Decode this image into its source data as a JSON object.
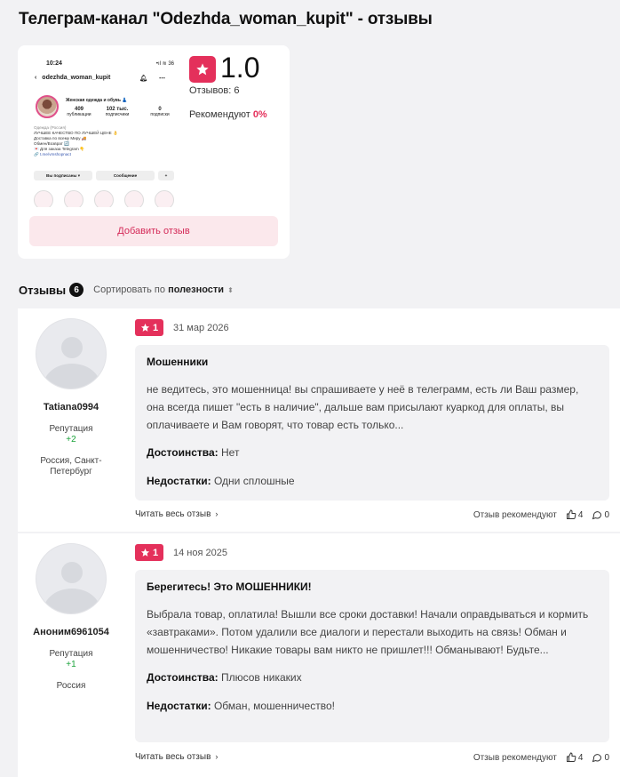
{
  "page": {
    "title": "Телеграм-канал \"Odezhda_woman_kupit\" - отзывы"
  },
  "summary": {
    "screenshot": {
      "time": "10:24",
      "status_right": "•ıl ≋ 36",
      "channel": "odezhda_woman_kupit",
      "name": "Женская одежда и обувь 👗",
      "stats": [
        {
          "value": "409",
          "label": "публикации"
        },
        {
          "value": "102 тыс.",
          "label": "подписчики"
        },
        {
          "value": "0",
          "label": "подписки"
        }
      ],
      "bio_lines": [
        "Одежда (Россия)",
        "ЛУЧШЕЕ КАЧЕСТВО ПО ЛУЧШЕЙ ЦЕНЕ 👌",
        "Доставка по всему Миру 🚚",
        "Обмен/Возврат 🔄",
        "💌 Для заказа Telegram 👇",
        "🔗 t.me/vmshopnact"
      ],
      "btn_subscribed": "Вы подписаны ▾",
      "btn_message": "Сообщение"
    },
    "rating": "1.0",
    "reviews_count": "Отзывов: 6",
    "recommend_label": "Рекомендуют",
    "recommend_value": "0%",
    "add_button": "Добавить отзыв"
  },
  "reviews_header": {
    "label": "Отзывы",
    "count": "6",
    "sort_prefix": "Сортировать по",
    "sort_value": "полезности"
  },
  "reviews": [
    {
      "username": "Tatiana0994",
      "reputation_label": "Репутация",
      "reputation_value": "+2",
      "location": "Россия, Санкт-Петербург",
      "rating": "1",
      "date": "31 мар 2026",
      "title": "Мошенники",
      "text": "не ведитесь, это мошенница! вы спрашиваете у неё в телеграмм, есть ли Ваш размер, она всегда пишет \"есть в наличие\", дальше вам присылают куаркод для оплаты, вы оплачиваете и Вам говорят, что товар есть только...",
      "pros_label": "Достоинства:",
      "pros": "Нет",
      "cons_label": "Недостатки:",
      "cons": "Одни сплошные",
      "read_more": "Читать весь отзыв",
      "recommend": "Отзыв рекомендуют",
      "likes": "4",
      "comments": "0"
    },
    {
      "username": "Аноним6961054",
      "reputation_label": "Репутация",
      "reputation_value": "+1",
      "location": "Россия",
      "rating": "1",
      "date": "14 ноя 2025",
      "title": "Берегитесь! Это МОШЕННИКИ!",
      "text": "Выбрала товар, оплатила! Вышли все сроки доставки! Начали оправдываться и кормить «завтраками». Потом удалили все диалоги и перестали выходить на связь! Обман и мошенничество! Никакие товары вам никто не пришлет!!! Обманывают! Будьте...",
      "pros_label": "Достоинства:",
      "pros": "Плюсов никаких",
      "cons_label": "Недостатки:",
      "cons": "Обман, мошенничество!",
      "read_more": "Читать весь отзыв",
      "recommend": "Отзыв рекомендуют",
      "likes": "4",
      "comments": "0"
    }
  ],
  "colors": {
    "accent": "#e4305b",
    "accent_bg": "#fbe8ec",
    "reputation": "#1ba33a",
    "page_bg": "#f2f2f4"
  }
}
